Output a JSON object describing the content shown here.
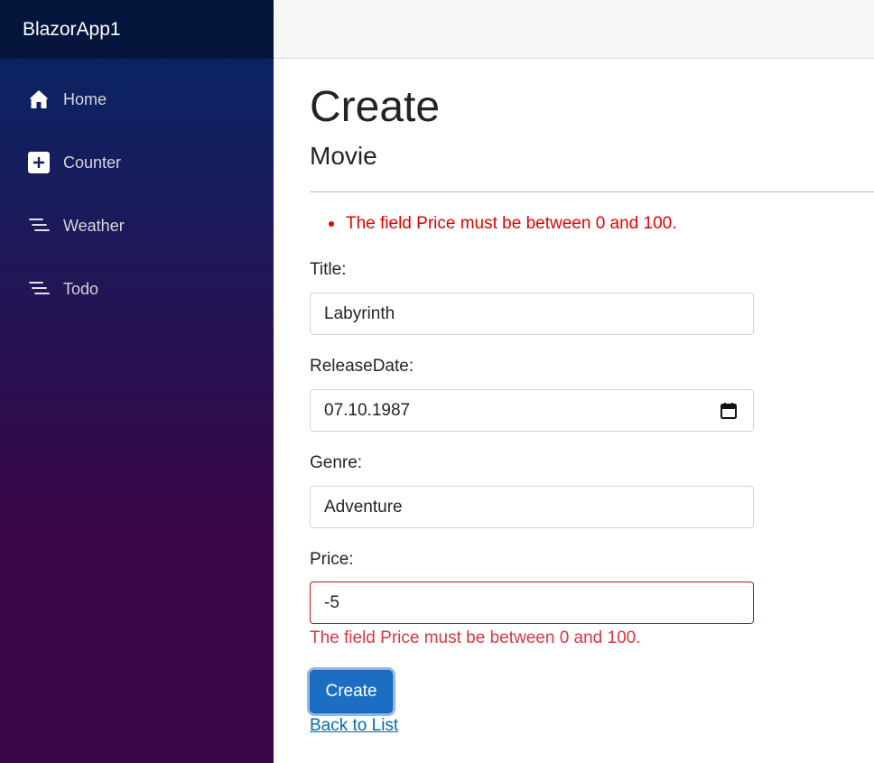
{
  "brand": "BlazorApp1",
  "nav": {
    "items": [
      {
        "label": "Home",
        "icon": "home-icon"
      },
      {
        "label": "Counter",
        "icon": "plus-square-icon"
      },
      {
        "label": "Weather",
        "icon": "list-lines-icon"
      },
      {
        "label": "Todo",
        "icon": "list-lines-icon"
      }
    ]
  },
  "page": {
    "title": "Create",
    "subtitle": "Movie"
  },
  "validation_summary": {
    "items": [
      "The field Price must be between 0 and 100."
    ]
  },
  "form": {
    "title": {
      "label": "Title:",
      "value": "Labyrinth"
    },
    "release_date": {
      "label": "ReleaseDate:",
      "value": "07.10.1987"
    },
    "genre": {
      "label": "Genre:",
      "value": "Adventure"
    },
    "price": {
      "label": "Price:",
      "value": "-5",
      "error": "The field Price must be between 0 and 100."
    },
    "submit_label": "Create",
    "back_link": "Back to List"
  },
  "colors": {
    "error": "#dc3545",
    "primary": "#1b6ec2",
    "link": "#006bb7",
    "sidebar_top": "#052767",
    "sidebar_bottom": "#3a0647"
  }
}
